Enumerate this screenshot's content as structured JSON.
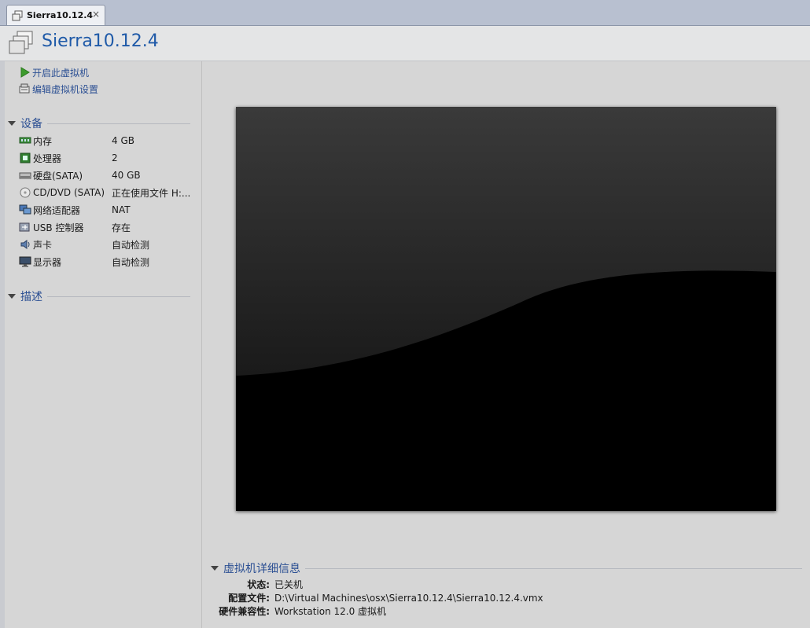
{
  "tab": {
    "label": "Sierra10.12.4",
    "close": "×"
  },
  "header": {
    "title": "Sierra10.12.4"
  },
  "actions": [
    {
      "label": "开启此虚拟机",
      "icon": "play-icon"
    },
    {
      "label": "编辑虚拟机设置",
      "icon": "settings-icon"
    }
  ],
  "devices": {
    "title": "设备",
    "items": [
      {
        "name": "内存",
        "value": "4 GB",
        "icon": "memory-icon"
      },
      {
        "name": "处理器",
        "value": "2",
        "icon": "cpu-icon"
      },
      {
        "name": "硬盘(SATA)",
        "value": "40 GB",
        "icon": "disk-icon"
      },
      {
        "name": "CD/DVD (SATA)",
        "value": "正在使用文件 H:...",
        "icon": "cd-icon"
      },
      {
        "name": "网络适配器",
        "value": "NAT",
        "icon": "network-icon"
      },
      {
        "name": "USB 控制器",
        "value": "存在",
        "icon": "usb-icon"
      },
      {
        "name": "声卡",
        "value": "自动检测",
        "icon": "sound-icon"
      },
      {
        "name": "显示器",
        "value": "自动检测",
        "icon": "monitor-icon"
      }
    ]
  },
  "description": {
    "title": "描述"
  },
  "details": {
    "title": "虚拟机详细信息",
    "rows": [
      {
        "key": "状态:",
        "value": "已关机"
      },
      {
        "key": "配置文件:",
        "value": "D:\\Virtual Machines\\osx\\Sierra10.12.4\\Sierra10.12.4.vmx"
      },
      {
        "key": "硬件兼容性:",
        "value": "Workstation 12.0 虚拟机"
      }
    ]
  },
  "colors": {
    "accent": "#2b4f93",
    "title": "#1f5aa8",
    "panel": "#d6d6d6"
  }
}
